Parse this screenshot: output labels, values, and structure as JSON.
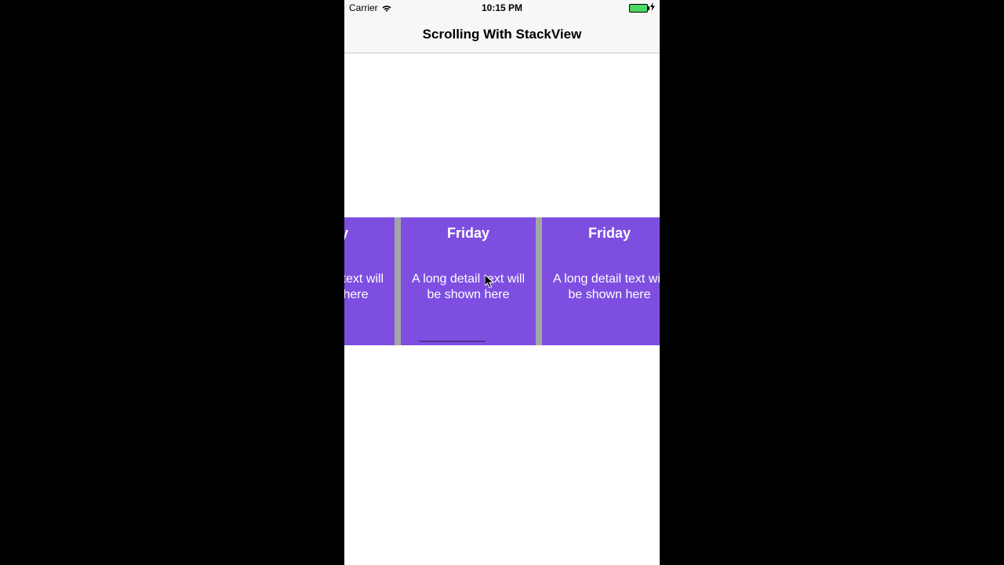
{
  "status_bar": {
    "carrier": "Carrier",
    "time": "10:15 PM",
    "battery_charging_symbol": "⚡"
  },
  "nav": {
    "title": "Scrolling With StackView"
  },
  "cards": [
    {
      "title": "Friday",
      "detail": "A long detail text will be shown here"
    },
    {
      "title": "Friday",
      "detail": "A long detail text will be shown here"
    },
    {
      "title": "Friday",
      "detail": "A long detail text will be shown here"
    }
  ]
}
